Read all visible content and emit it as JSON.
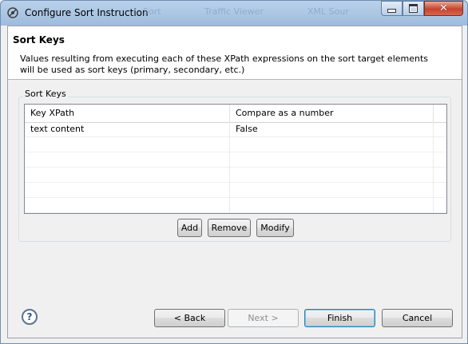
{
  "window": {
    "title": "Configure Sort Instruction",
    "background_tabs": [
      "Sort",
      "Traffic Viewer",
      "XML Sour"
    ]
  },
  "header": {
    "title": "Sort Keys",
    "description": "Values resulting from executing each of these XPath expressions on the sort target elements will be used as sort keys (primary, secondary, etc.)"
  },
  "group": {
    "label": "Sort Keys"
  },
  "table": {
    "columns": [
      "Key XPath",
      "Compare as a number"
    ],
    "rows": [
      [
        "text content",
        "False"
      ],
      [
        "",
        ""
      ],
      [
        "",
        ""
      ],
      [
        "",
        ""
      ],
      [
        "",
        ""
      ],
      [
        "",
        ""
      ]
    ]
  },
  "buttons": {
    "add": "Add",
    "remove": "Remove",
    "modify": "Modify",
    "back": "< Back",
    "next": "Next >",
    "finish": "Finish",
    "cancel": "Cancel",
    "help": "?"
  },
  "icons": {
    "title": "sort-config-icon",
    "minimize": "minimize-icon",
    "maximize": "maximize-icon",
    "close": "close-icon",
    "help": "help-icon"
  },
  "colors": {
    "titlebar": "#b9d1ea",
    "close_button": "#c6432e",
    "default_button_border": "#3c7fb1"
  }
}
